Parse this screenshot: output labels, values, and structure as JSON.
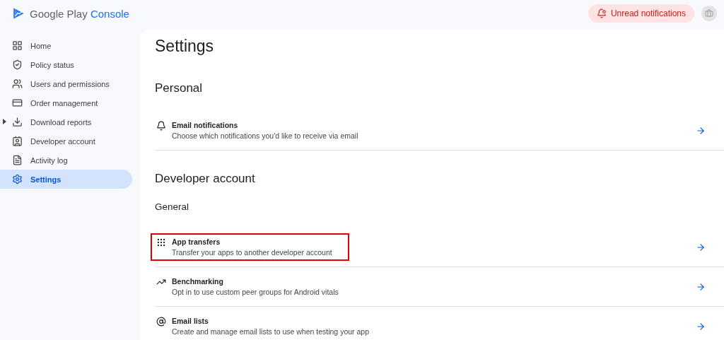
{
  "header": {
    "logo_word": "Google Play",
    "logo_accent": "Console",
    "notification_button": "Unread notifications"
  },
  "sidebar": {
    "items": [
      {
        "label": "Home",
        "selected": false
      },
      {
        "label": "Policy status",
        "selected": false
      },
      {
        "label": "Users and permissions",
        "selected": false
      },
      {
        "label": "Order management",
        "selected": false
      },
      {
        "label": "Download reports",
        "selected": false,
        "expanded": false
      },
      {
        "label": "Developer account",
        "selected": false
      },
      {
        "label": "Activity log",
        "selected": false
      },
      {
        "label": "Settings",
        "selected": true
      }
    ]
  },
  "page": {
    "title": "Settings",
    "sections": [
      {
        "heading": "Personal",
        "groups": [
          {
            "items": [
              {
                "title": "Email notifications",
                "description": "Choose which notifications you'd like to receive via email",
                "highlighted": false
              }
            ]
          }
        ]
      },
      {
        "heading": "Developer account",
        "groups": [
          {
            "heading": "General",
            "items": [
              {
                "title": "App transfers",
                "description": "Transfer your apps to another developer account",
                "highlighted": true
              },
              {
                "title": "Benchmarking",
                "description": "Opt in to use custom peer groups for Android vitals",
                "highlighted": false
              },
              {
                "title": "Email lists",
                "description": "Create and manage email lists to use when testing your app",
                "highlighted": false
              }
            ]
          }
        ]
      }
    ]
  }
}
